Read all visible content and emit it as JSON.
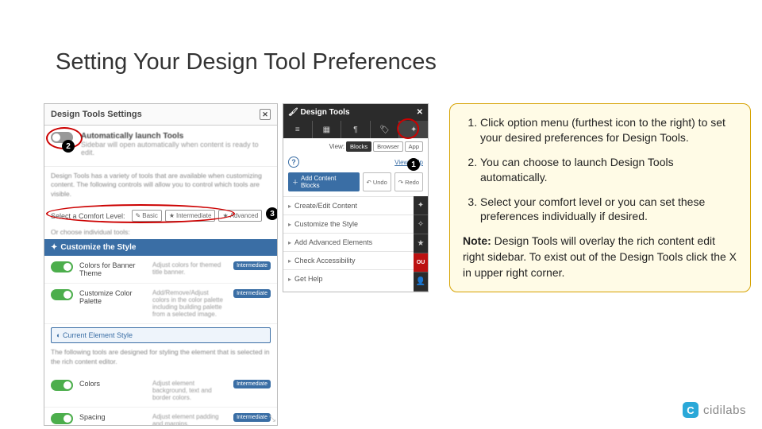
{
  "slide": {
    "title": "Setting Your Design Tool Preferences"
  },
  "settings": {
    "header": "Design Tools Settings",
    "auto_launch_title": "Automatically launch Tools",
    "auto_launch_desc": "Sidebar will open automatically when content is ready to edit.",
    "variety_para": "Design Tools has a variety of tools that are available when customizing content. The following controls will allow you to control which tools are visible.",
    "comfort_label": "Select a Comfort Level:",
    "comfort_levels": [
      "Basic",
      "Intermediate",
      "Advanced"
    ],
    "or_choose": "Or choose individual tools:",
    "section_customize": "Customize the Style",
    "rows": [
      {
        "name": "Colors for Banner Theme",
        "desc": "Adjust colors for themed title banner.",
        "badge": "Intermediate"
      },
      {
        "name": "Customize Color Palette",
        "desc": "Add/Remove/Adjust colors in the color palette including building palette from a selected image.",
        "badge": "Intermediate"
      }
    ],
    "current_element": "Current Element Style",
    "elem_para": "The following tools are designed for styling the element that is selected in the rich content editor.",
    "rows2": [
      {
        "name": "Colors",
        "desc": "Adjust element background, text and border colors.",
        "badge": "Intermediate"
      },
      {
        "name": "Spacing",
        "desc": "Adjust element padding and margins.",
        "badge": "Intermediate"
      }
    ]
  },
  "callouts": {
    "n1": "1",
    "n2": "2",
    "n3": "3"
  },
  "dt": {
    "title": "Design Tools",
    "view_label": "View:",
    "view_options": [
      "Blocks",
      "Browser",
      "App"
    ],
    "help_link": "View Help",
    "add_blocks": "Add Content Blocks",
    "undo": "Undo",
    "redo": "Redo",
    "menu": [
      "Create/Edit Content",
      "Customize the Style",
      "Add Advanced Elements",
      "Check Accessibility",
      "Get Help"
    ]
  },
  "instructions": {
    "items": [
      "Click option menu (furthest icon to the right) to set your desired preferences for Design Tools.",
      "You can choose to launch Design Tools automatically.",
      "Select your comfort level or you can set these preferences individually if desired."
    ],
    "note_label": "Note:",
    "note_text": " Design Tools will overlay the rich content edit right sidebar. To exist out of the Design Tools click the X in upper right corner."
  },
  "footer": {
    "logo_letter": "C",
    "brand": "cidilabs"
  }
}
